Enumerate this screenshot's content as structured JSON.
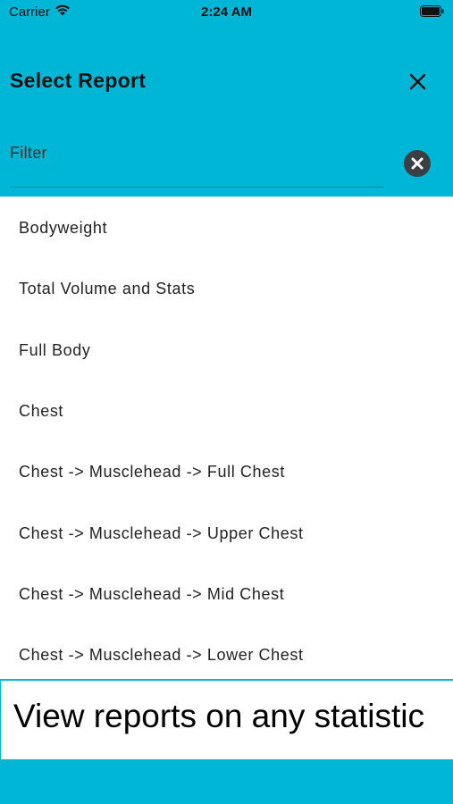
{
  "status_bar": {
    "carrier": "Carrier",
    "time": "2:24 AM",
    "wifi_icon": "wifi-icon",
    "battery_icon": "battery-icon"
  },
  "header": {
    "title": "Select Report",
    "close_icon": "close-icon",
    "filter_placeholder": "Filter",
    "clear_icon": "clear-circle-icon"
  },
  "reports": [
    "Bodyweight",
    "Total Volume and Stats",
    "Full Body",
    "Chest",
    "Chest -> Musclehead -> Full Chest",
    "Chest -> Musclehead -> Upper Chest",
    "Chest -> Musclehead -> Mid Chest",
    "Chest -> Musclehead -> Lower Chest"
  ],
  "promo": {
    "text": "View reports on any statistic"
  },
  "colors": {
    "header_background": "#00b6d6",
    "text_primary": "#222222",
    "clear_button": "#3a3f44"
  }
}
